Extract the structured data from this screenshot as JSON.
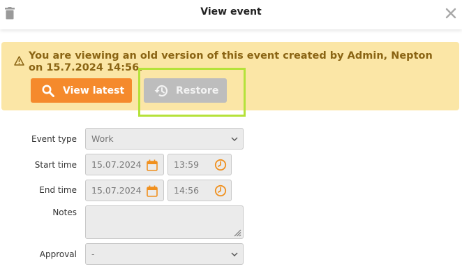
{
  "dialog": {
    "title": "View event"
  },
  "banner": {
    "message": "You are viewing an old version of this event created by Admin, Nepton on 15.7.2024 14:56.",
    "view_latest_label": "View latest",
    "restore_label": "Restore"
  },
  "form": {
    "event_type": {
      "label": "Event type",
      "value": "Work"
    },
    "start_time": {
      "label": "Start time",
      "date": "15.07.2024",
      "time": "13:59"
    },
    "end_time": {
      "label": "End time",
      "date": "15.07.2024",
      "time": "14:56"
    },
    "notes": {
      "label": "Notes",
      "value": ""
    },
    "approval": {
      "label": "Approval",
      "value": "-"
    }
  },
  "colors": {
    "banner_bg": "#fbe6a6",
    "banner_text": "#8a6413",
    "primary_button": "#f58a2c",
    "disabled_button": "#bdbdbd",
    "highlight": "#b5e23a",
    "icon_accent": "#f0901e"
  },
  "icons": [
    "trash-icon",
    "close-icon",
    "warning-icon",
    "search-icon",
    "history-icon",
    "chevron-down-icon",
    "calendar-icon",
    "clock-icon",
    "resize-grip-icon"
  ]
}
